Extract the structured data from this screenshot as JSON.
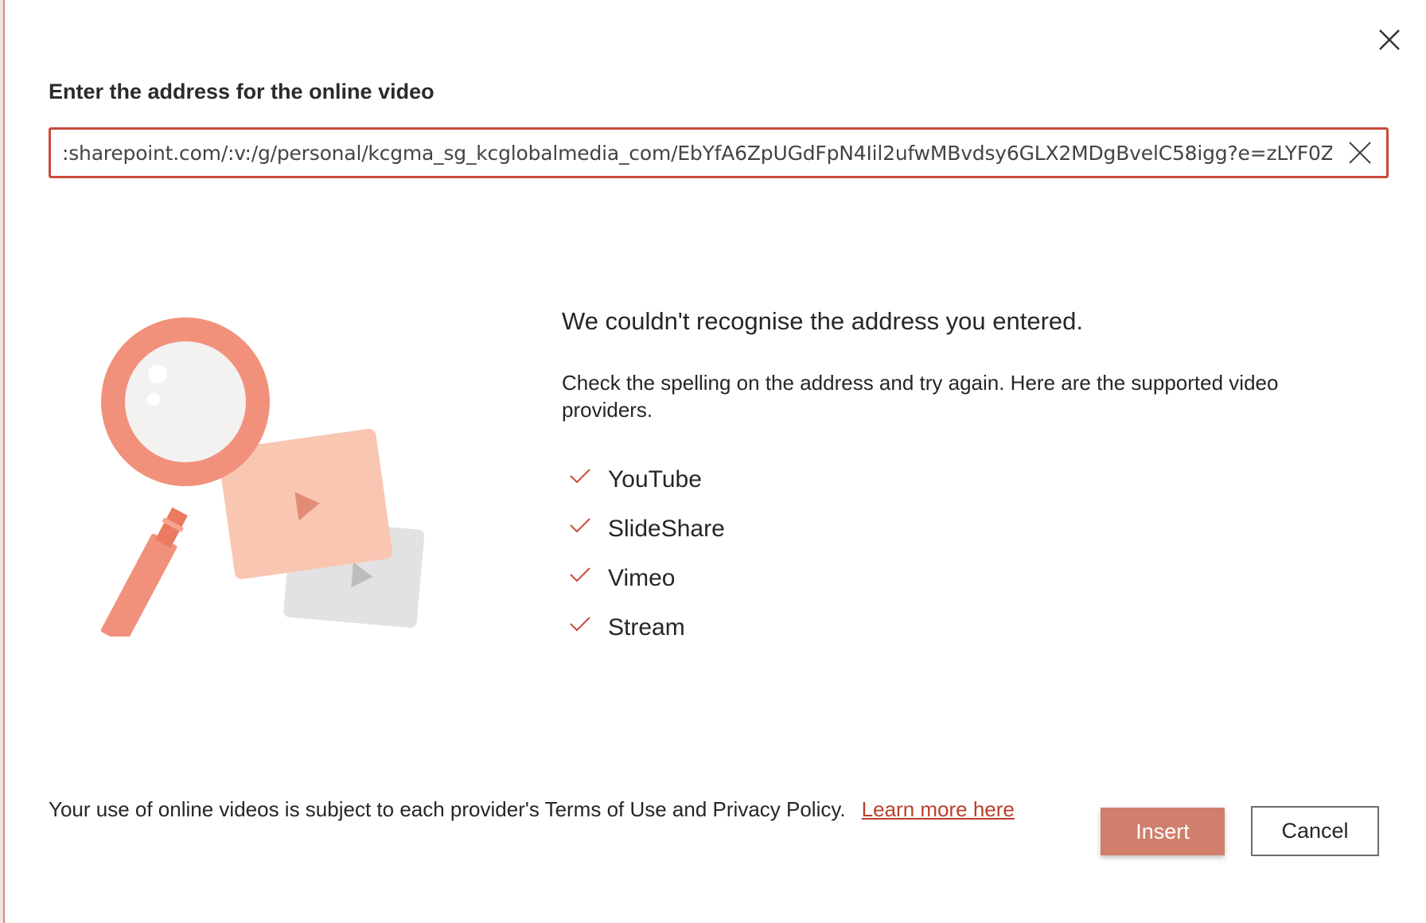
{
  "dialog": {
    "heading": "Enter the address for the online video",
    "url_value": ":sharepoint.com/:v:/g/personal/kcgma_sg_kcglobalmedia_com/EbYfA6ZpUGdFpN4Iil2ufwMBvdsy6GLX2MDgBvelC58igg?e=zLYF0Z",
    "close_icon": "close-icon",
    "clear_icon": "clear-icon"
  },
  "error": {
    "title": "We couldn't recognise the address you entered.",
    "body": "Check the spelling on the address and try again. Here are the supported video providers.",
    "providers": [
      "YouTube",
      "SlideShare",
      "Vimeo",
      "Stream"
    ],
    "check_icon": "checkmark-icon"
  },
  "footer": {
    "terms": "Your use of online videos is subject to each provider's Terms of Use and Privacy Policy.",
    "link": "Learn more here"
  },
  "buttons": {
    "insert": "Insert",
    "cancel": "Cancel"
  },
  "colors": {
    "accent": "#c94a3a",
    "insert_bg": "#cf7f6c",
    "link": "#b8412b"
  }
}
